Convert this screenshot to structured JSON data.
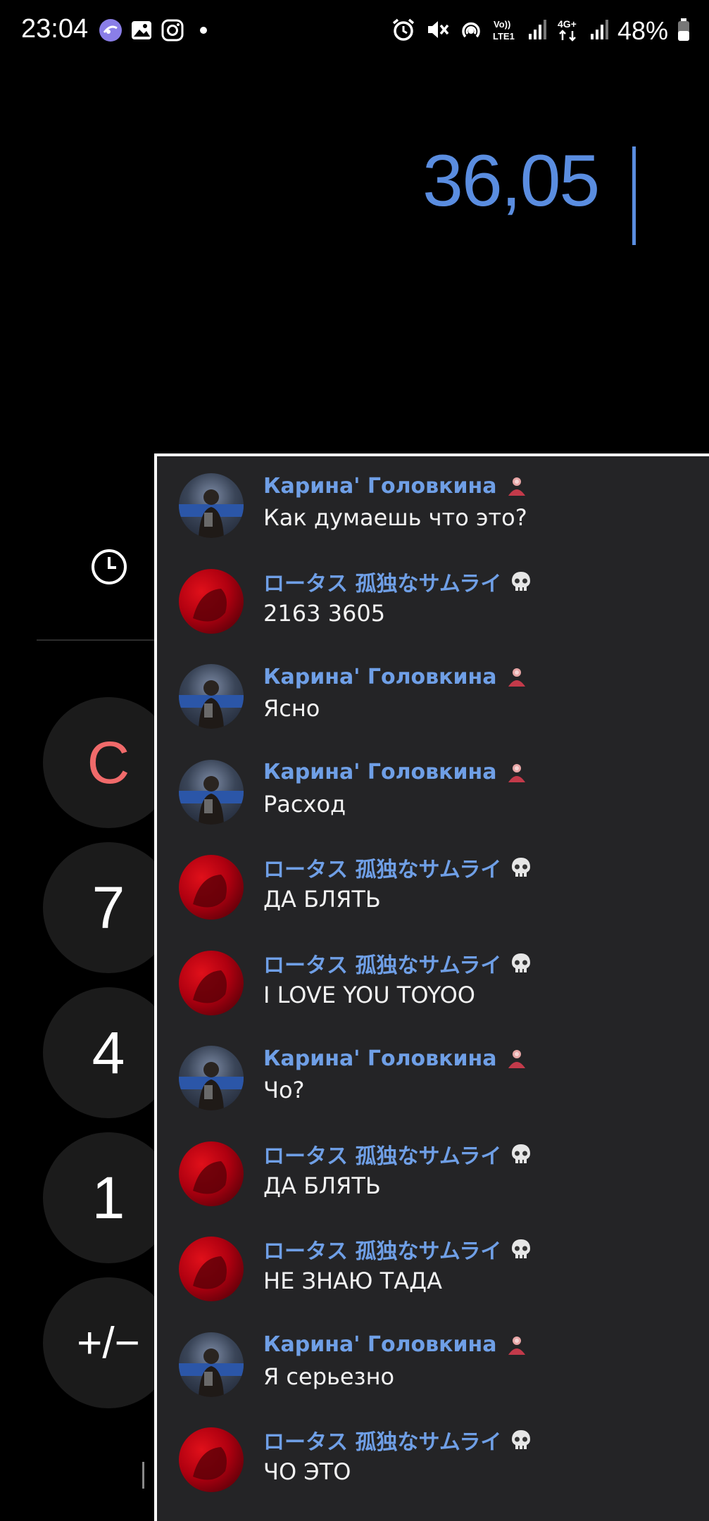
{
  "status_bar": {
    "time": "23:04",
    "battery": "48%",
    "network_left": "Vo)) LTE1",
    "network_right": "4G+",
    "icons": [
      "galaxy-app-icon",
      "gallery-icon",
      "instagram-icon",
      "dot-icon",
      "alarm-icon",
      "mute-icon",
      "hotspot-icon",
      "volte-icon",
      "signal-icon",
      "4g-plus-icon",
      "signal-icon",
      "battery-icon"
    ]
  },
  "calculator": {
    "display_value": "36,05",
    "keys": {
      "clear": "C",
      "seven": "7",
      "four": "4",
      "one": "1",
      "sign": "+/−"
    },
    "colors": {
      "display": "#5a8de0",
      "clear": "#f06a6a",
      "key_bg": "#1b1b1b"
    }
  },
  "chat": {
    "colors": {
      "background": "#242426",
      "author": "#6f9fe6",
      "text": "#f2f2f2"
    },
    "messages": [
      {
        "author": "Карина' Головкина",
        "text": "Как думаешь что это?",
        "avatar": "photo",
        "badge": "user-badge-icon"
      },
      {
        "author": "ロータス 孤独なサムライ",
        "text": "2163 3605",
        "avatar": "red",
        "badge": "skull-icon"
      },
      {
        "author": "Карина' Головкина",
        "text": "Ясно",
        "avatar": "photo",
        "badge": "user-badge-icon"
      },
      {
        "author": "Карина' Головкина",
        "text": "Расход",
        "avatar": "photo",
        "badge": "user-badge-icon"
      },
      {
        "author": "ロータス 孤独なサムライ",
        "text": "ДА БЛЯТЬ",
        "avatar": "red",
        "badge": "skull-icon"
      },
      {
        "author": "ロータス 孤独なサムライ",
        "text": "I LOVE YOU TOYOO",
        "avatar": "red",
        "badge": "skull-icon"
      },
      {
        "author": "Карина' Головкина",
        "text": "Чо?",
        "avatar": "photo",
        "badge": "user-badge-icon"
      },
      {
        "author": "ロータス 孤独なサムライ",
        "text": "ДА БЛЯТЬ",
        "avatar": "red",
        "badge": "skull-icon"
      },
      {
        "author": "ロータス 孤独なサムライ",
        "text": "НЕ ЗНАЮ ТАДА",
        "avatar": "red",
        "badge": "skull-icon"
      },
      {
        "author": "Карина' Головкина",
        "text": "Я серьезно",
        "avatar": "photo",
        "badge": "user-badge-icon"
      },
      {
        "author": "ロータス 孤独なサムライ",
        "text": "ЧО ЭТО",
        "avatar": "red",
        "badge": "skull-icon"
      }
    ]
  }
}
